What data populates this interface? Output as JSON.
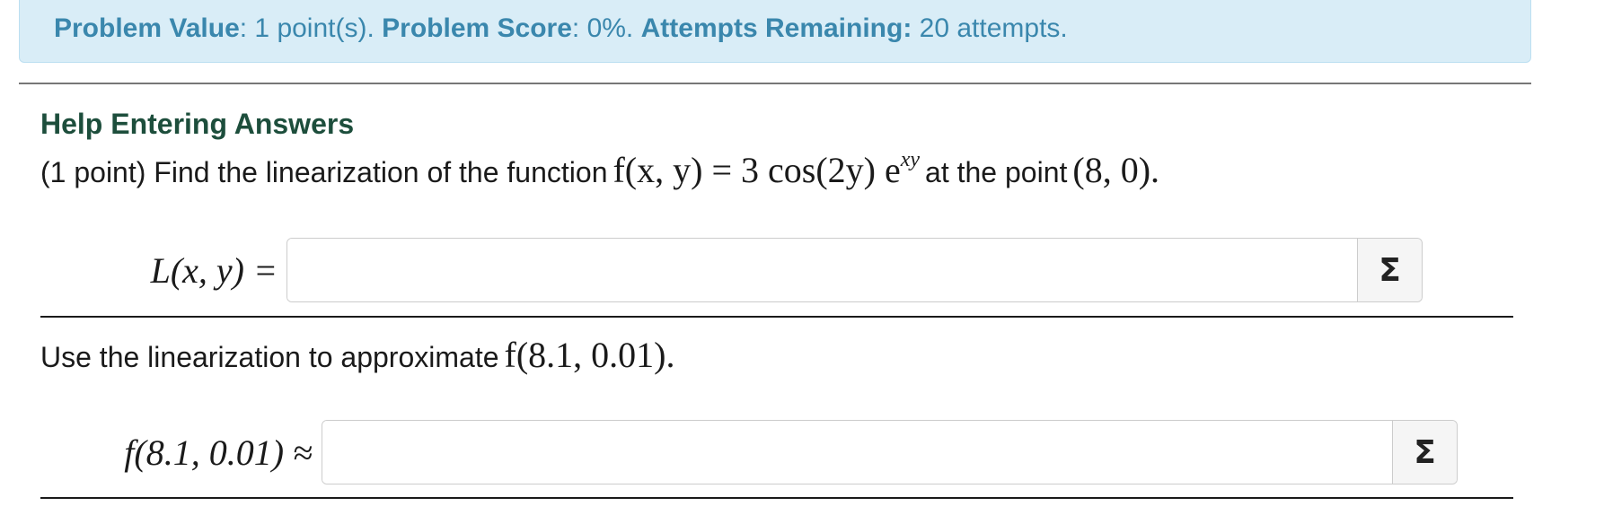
{
  "info": {
    "value_label": "Problem Value",
    "value_text": ": 1 point(s).",
    "score_label": "Problem Score",
    "score_text": ": 0%.",
    "attempts_label": "Attempts Remaining:",
    "attempts_text": "20 attempts."
  },
  "problem": {
    "help_link": "Help Entering Answers",
    "intro_text": "(1 point) Find the linearization of the function",
    "function_prefix": "f(x, y) = 3 cos(2y) e",
    "function_exponent": "xy",
    "at_point_text": "at the point",
    "point": "(8, 0).",
    "part2_text": "Use the linearization to approximate",
    "part2_math": "f(8.1, 0.01)."
  },
  "answers": [
    {
      "label": "L(x, y) =",
      "value": "",
      "equation_button": "Σ"
    },
    {
      "label": "f(8.1, 0.01) ≈",
      "value": "",
      "equation_button": "Σ"
    }
  ],
  "colors": {
    "info_background": "#d9edf7",
    "info_text": "#3a87ad",
    "help_link": "#1d4e3c"
  }
}
